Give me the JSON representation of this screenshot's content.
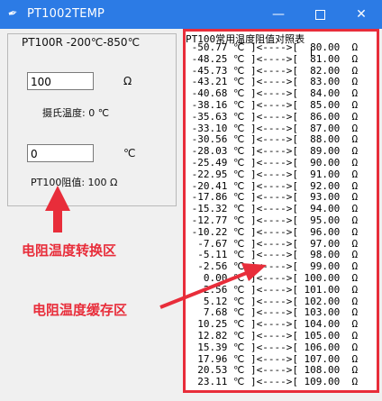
{
  "window": {
    "title": "PT1002TEMP",
    "icon": "feather-icon",
    "controls": {
      "minimize": "—",
      "maximize": "",
      "close": "✕"
    }
  },
  "converter": {
    "range_label": "PT100R -200℃-850℃",
    "resistance_value": "100",
    "resistance_unit": "Ω",
    "celsius_label": "摄氏温度: 0 ℃",
    "temperature_value": "0",
    "temperature_unit": "℃",
    "pt100_label": "PT100阻值: 100 Ω"
  },
  "annotations": {
    "converter_area": "电阻温度转换区",
    "cache_area": "电阻温度缓存区",
    "color": "#e82d3a"
  },
  "table": {
    "header": "PT100常用温度阻值对照表",
    "rows": [
      " -50.77 ℃ ]<---->[  80.00  Ω",
      " -48.25 ℃ ]<---->[  81.00  Ω",
      " -45.73 ℃ ]<---->[  82.00  Ω",
      " -43.21 ℃ ]<---->[  83.00  Ω",
      " -40.68 ℃ ]<---->[  84.00  Ω",
      " -38.16 ℃ ]<---->[  85.00  Ω",
      " -35.63 ℃ ]<---->[  86.00  Ω",
      " -33.10 ℃ ]<---->[  87.00  Ω",
      " -30.56 ℃ ]<---->[  88.00  Ω",
      " -28.03 ℃ ]<---->[  89.00  Ω",
      " -25.49 ℃ ]<---->[  90.00  Ω",
      " -22.95 ℃ ]<---->[  91.00  Ω",
      " -20.41 ℃ ]<---->[  92.00  Ω",
      " -17.86 ℃ ]<---->[  93.00  Ω",
      " -15.32 ℃ ]<---->[  94.00  Ω",
      " -12.77 ℃ ]<---->[  95.00  Ω",
      " -10.22 ℃ ]<---->[  96.00  Ω",
      "  -7.67 ℃ ]<---->[  97.00  Ω",
      "  -5.11 ℃ ]<---->[  98.00  Ω",
      "  -2.56 ℃ ]<---->[  99.00  Ω",
      "   0.00 ℃ ]<---->[ 100.00  Ω",
      "   2.56 ℃ ]<---->[ 101.00  Ω",
      "   5.12 ℃ ]<---->[ 102.00  Ω",
      "   7.68 ℃ ]<---->[ 103.00  Ω",
      "  10.25 ℃ ]<---->[ 104.00  Ω",
      "  12.82 ℃ ]<---->[ 105.00  Ω",
      "  15.39 ℃ ]<---->[ 106.00  Ω",
      "  17.96 ℃ ]<---->[ 107.00  Ω",
      "  20.53 ℃ ]<---->[ 108.00  Ω",
      "  23.11 ℃ ]<---->[ 109.00  Ω"
    ]
  }
}
